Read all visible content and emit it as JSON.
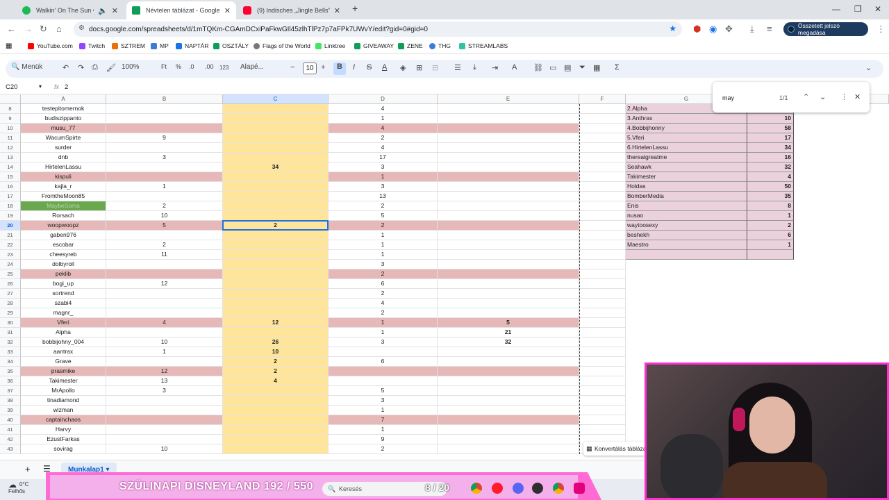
{
  "browser": {
    "tabs": [
      {
        "title": "Walkin' On The Sun • Smas",
        "color": "#1db954",
        "active": false
      },
      {
        "title": "Névtelen táblázat - Google Tábl",
        "color": "#0f9d58",
        "active": true
      },
      {
        "title": "(9) Indisches „Jingle Bells\" 😁",
        "color": "#ff0033",
        "active": false
      }
    ],
    "new_tab": "+",
    "url": "docs.google.com/spreadsheets/d/1mTQKm-CGAmDCxiPaFkwGIl45zlhTlPz7p7aFPk7UWvY/edit?gid=0#gid=0",
    "password_button": "Összetett jelszó megadása"
  },
  "bookmarks": [
    {
      "label": "YouTube.com",
      "color": "#ff0000"
    },
    {
      "label": "Twitch",
      "color": "#9146ff"
    },
    {
      "label": "SZTREM",
      "color": "#e8710a"
    },
    {
      "label": "MP",
      "color": "#3c7bd6"
    },
    {
      "label": "NAPTÁR",
      "color": "#1a73e8"
    },
    {
      "label": "OSZTÁLY",
      "color": "#0f9d58"
    },
    {
      "label": "Flags of the World",
      "color": "#777777"
    },
    {
      "label": "Linktree",
      "color": "#43e660"
    },
    {
      "label": "GIVEAWAY",
      "color": "#0f9d58"
    },
    {
      "label": "ZENE",
      "color": "#0f9d58"
    },
    {
      "label": "THG",
      "color": "#3c7bd6"
    },
    {
      "label": "STREAMLABS",
      "color": "#31c3a2"
    }
  ],
  "toolbar": {
    "menus_label": "Menük",
    "zoom": "100%",
    "ft": "Ft",
    "percent": "%",
    "dec_less": ".0",
    "dec_more": ".00",
    "num_fmt": "123",
    "font": "Alapé...",
    "font_size": "10"
  },
  "formula_bar": {
    "cell_ref": "C20",
    "fx": "fx",
    "value": "2"
  },
  "columns": [
    "A",
    "B",
    "C",
    "D",
    "E",
    "F",
    "G"
  ],
  "rows": [
    {
      "n": "8",
      "pink": false,
      "a": "testepitomernok",
      "b": "",
      "c": "",
      "d": "4",
      "e": ""
    },
    {
      "n": "9",
      "pink": false,
      "a": "budiszippanto",
      "b": "",
      "c": "",
      "d": "1",
      "e": ""
    },
    {
      "n": "10",
      "pink": true,
      "a": "musu_77",
      "b": "",
      "c": "",
      "d": "4",
      "e": ""
    },
    {
      "n": "11",
      "pink": false,
      "a": "WacumSpirte",
      "b": "9",
      "c": "",
      "d": "2",
      "e": ""
    },
    {
      "n": "12",
      "pink": false,
      "a": "surder",
      "b": "",
      "c": "",
      "d": "4",
      "e": ""
    },
    {
      "n": "13",
      "pink": false,
      "a": "dnb",
      "b": "3",
      "c": "",
      "d": "17",
      "e": ""
    },
    {
      "n": "14",
      "pink": false,
      "a": "HirtelenLassu",
      "b": "",
      "c": "34",
      "d": "3",
      "e": ""
    },
    {
      "n": "15",
      "pink": true,
      "a": "kispuli",
      "b": "",
      "c": "",
      "d": "1",
      "e": ""
    },
    {
      "n": "16",
      "pink": false,
      "a": "kajla_r",
      "b": "1",
      "c": "",
      "d": "3",
      "e": ""
    },
    {
      "n": "17",
      "pink": false,
      "a": "FromtheMoon85",
      "b": "",
      "c": "",
      "d": "13",
      "e": ""
    },
    {
      "n": "18",
      "pink": false,
      "green": true,
      "a": "MaybeSoma",
      "b": "2",
      "c": "",
      "d": "2",
      "e": ""
    },
    {
      "n": "19",
      "pink": false,
      "a": "Rorsach",
      "b": "10",
      "c": "",
      "d": "5",
      "e": ""
    },
    {
      "n": "20",
      "pink": true,
      "a": "woopwoopz",
      "b": "5",
      "c": "2",
      "d": "2",
      "e": ""
    },
    {
      "n": "21",
      "pink": false,
      "a": "gaben976",
      "b": "",
      "c": "",
      "d": "1",
      "e": ""
    },
    {
      "n": "22",
      "pink": false,
      "a": "escobar",
      "b": "2",
      "c": "",
      "d": "1",
      "e": ""
    },
    {
      "n": "23",
      "pink": false,
      "a": "cheesyreb",
      "b": "11",
      "c": "",
      "d": "1",
      "e": ""
    },
    {
      "n": "24",
      "pink": false,
      "a": "dolbyroll",
      "b": "",
      "c": "",
      "d": "3",
      "e": ""
    },
    {
      "n": "25",
      "pink": true,
      "a": "peklib",
      "b": "",
      "c": "",
      "d": "2",
      "e": ""
    },
    {
      "n": "26",
      "pink": false,
      "a": "bogi_up",
      "b": "12",
      "c": "",
      "d": "6",
      "e": ""
    },
    {
      "n": "27",
      "pink": false,
      "a": "sortrend",
      "b": "",
      "c": "",
      "d": "2",
      "e": ""
    },
    {
      "n": "28",
      "pink": false,
      "a": "szabi4",
      "b": "",
      "c": "",
      "d": "4",
      "e": ""
    },
    {
      "n": "29",
      "pink": false,
      "a": "magnr_",
      "b": "",
      "c": "",
      "d": "2",
      "e": ""
    },
    {
      "n": "30",
      "pink": true,
      "a": "Vferi",
      "b": "4",
      "c": "12",
      "d": "1",
      "e": "5"
    },
    {
      "n": "31",
      "pink": false,
      "a": "Alpha",
      "b": "",
      "c": "",
      "d": "1",
      "e": "21"
    },
    {
      "n": "32",
      "pink": false,
      "a": "bobbijohny_004",
      "b": "10",
      "c": "26",
      "d": "3",
      "e": "32"
    },
    {
      "n": "33",
      "pink": false,
      "a": "aantrax",
      "b": "1",
      "c": "10",
      "d": "",
      "e": ""
    },
    {
      "n": "34",
      "pink": false,
      "a": "Grave",
      "b": "",
      "c": "2",
      "d": "6",
      "e": ""
    },
    {
      "n": "35",
      "pink": true,
      "a": "prasmike",
      "b": "12",
      "c": "2",
      "d": "",
      "e": ""
    },
    {
      "n": "36",
      "pink": false,
      "a": "Takimester",
      "b": "13",
      "c": "4",
      "d": "",
      "e": ""
    },
    {
      "n": "37",
      "pink": false,
      "a": "MrApollo",
      "b": "3",
      "c": "",
      "d": "5",
      "e": ""
    },
    {
      "n": "38",
      "pink": false,
      "a": "tinadiamond",
      "b": "",
      "c": "",
      "d": "3",
      "e": ""
    },
    {
      "n": "39",
      "pink": false,
      "a": "wizman",
      "b": "",
      "c": "",
      "d": "1",
      "e": ""
    },
    {
      "n": "40",
      "pink": true,
      "a": "captainchaos",
      "b": "",
      "c": "",
      "d": "7",
      "e": ""
    },
    {
      "n": "41",
      "pink": false,
      "a": "Harvy",
      "b": "",
      "c": "",
      "d": "1",
      "e": ""
    },
    {
      "n": "42",
      "pink": false,
      "a": "EzustFarkas",
      "b": "",
      "c": "",
      "d": "9",
      "e": ""
    },
    {
      "n": "43",
      "pink": false,
      "a": "sovirag",
      "b": "10",
      "c": "",
      "d": "2",
      "e": ""
    }
  ],
  "side_table": [
    {
      "name": "2.Alpha",
      "value": ""
    },
    {
      "name": "3.Anthrax",
      "value": "10"
    },
    {
      "name": "4.Bobbijhonny",
      "value": "58"
    },
    {
      "name": "5.Vferi",
      "value": "17"
    },
    {
      "name": "6.HirtelenLassu",
      "value": "34"
    },
    {
      "name": "therealgreatme",
      "value": "16"
    },
    {
      "name": "Seahawk",
      "value": "32"
    },
    {
      "name": "Takimester",
      "value": "4"
    },
    {
      "name": "Holdas",
      "value": "50"
    },
    {
      "name": "BomberMedia",
      "value": "35"
    },
    {
      "name": "Enis",
      "value": "8"
    },
    {
      "name": "nusao",
      "value": "1"
    },
    {
      "name": "waytoosexy",
      "value": "2"
    },
    {
      "name": "beshekh",
      "value": "6"
    },
    {
      "name": "Maestro",
      "value": "1"
    },
    {
      "name": "",
      "value": ""
    }
  ],
  "find": {
    "query": "may",
    "count": "1/1"
  },
  "sheet_tab": "Munkalap1",
  "convert_label": "Konvertálás táblázattá",
  "taskbar": {
    "temp": "0°C",
    "weather": "Felhős",
    "banner": "SZÜLINAPI DISNEYLAND  192 / 550",
    "search": "Keresés",
    "counter": "8 / 20"
  }
}
